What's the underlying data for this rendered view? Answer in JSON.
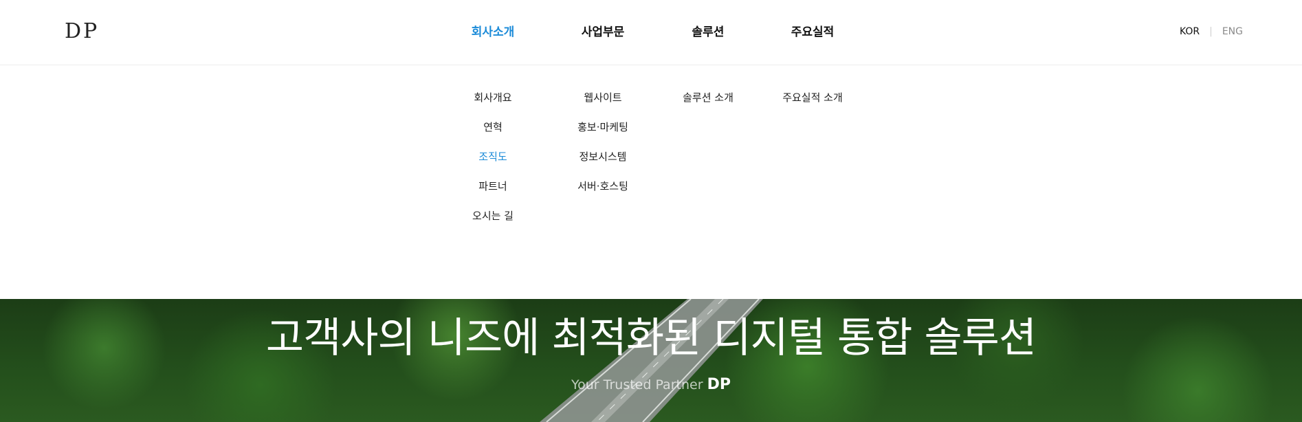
{
  "header": {
    "logo": "DP",
    "nav": [
      {
        "label": "회사소개",
        "active": true
      },
      {
        "label": "사업부문",
        "active": false
      },
      {
        "label": "솔루션",
        "active": false
      },
      {
        "label": "주요실적",
        "active": false
      }
    ],
    "lang": {
      "kor": "KOR",
      "separator": "|",
      "eng": "ENG"
    }
  },
  "dropdown": {
    "columns": [
      {
        "items": [
          {
            "label": "회사개요",
            "active": false
          },
          {
            "label": "연혁",
            "active": false
          },
          {
            "label": "조직도",
            "active": true
          },
          {
            "label": "파트너",
            "active": false
          },
          {
            "label": "오시는 길",
            "active": false
          }
        ]
      },
      {
        "items": [
          {
            "label": "웹사이트",
            "active": false
          },
          {
            "label": "홍보·마케팅",
            "active": false
          },
          {
            "label": "정보시스템",
            "active": false
          },
          {
            "label": "서버·호스팅",
            "active": false
          }
        ]
      },
      {
        "items": [
          {
            "label": "솔루션 소개",
            "active": false
          }
        ]
      },
      {
        "items": [
          {
            "label": "주요실적 소개",
            "active": false
          }
        ]
      }
    ]
  },
  "hero": {
    "title": "고객사의 니즈에 최적화된 디지털 통합 솔루션",
    "subtitle_prefix": "Your Trusted Partner",
    "subtitle_brand": "DP"
  },
  "colors": {
    "accent": "#1a8ad8",
    "text": "#111111",
    "muted": "#8a8a8a",
    "forest": "#24501c"
  },
  "icons": []
}
